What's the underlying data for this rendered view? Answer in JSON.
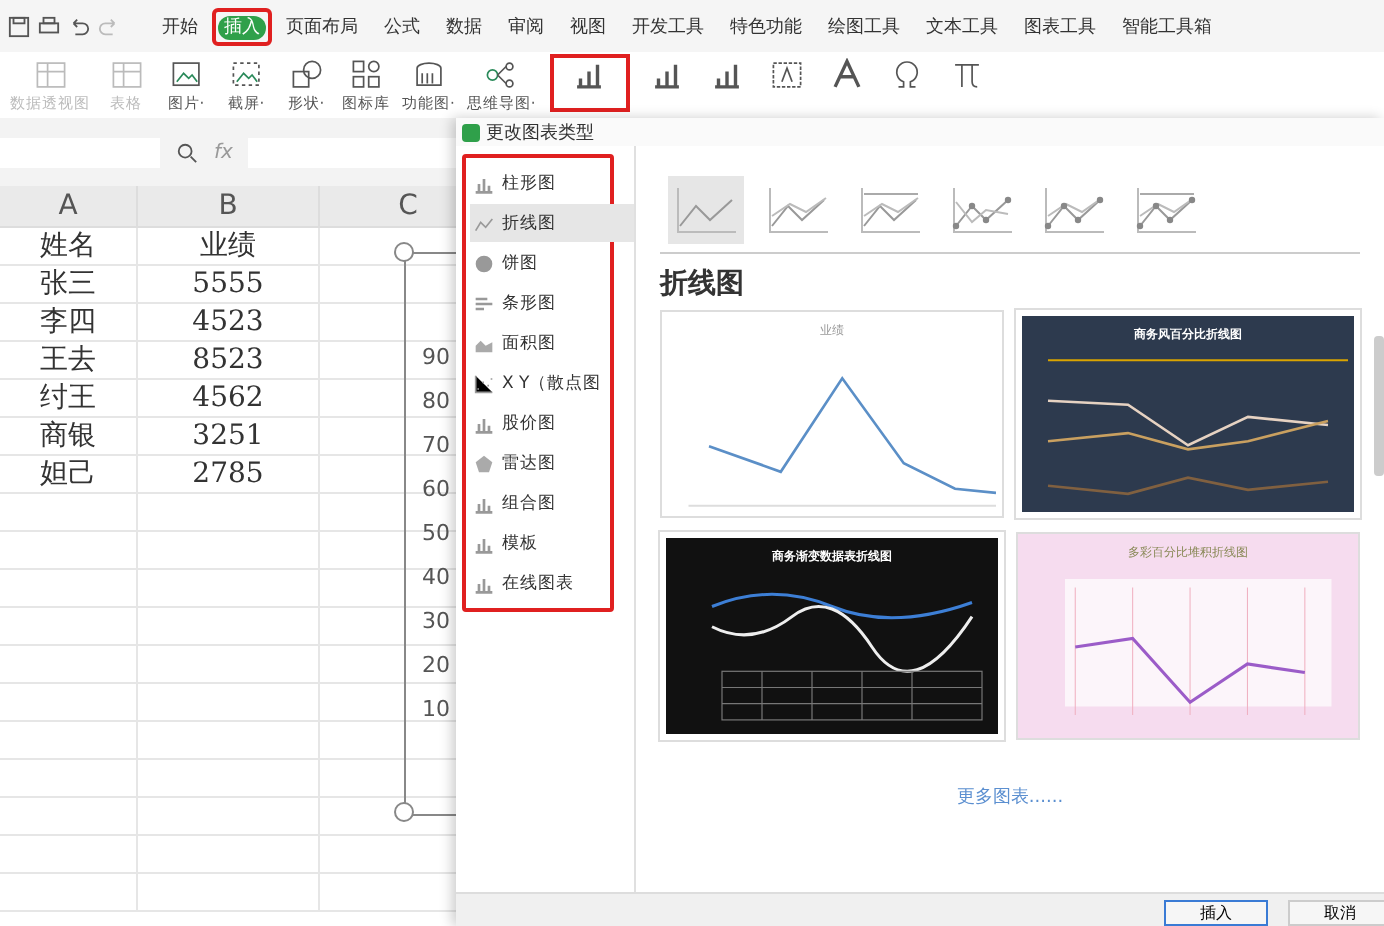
{
  "menu_tabs": [
    {
      "label": "开始",
      "selected": false,
      "annotated": false
    },
    {
      "label": "插入",
      "selected": true,
      "annotated": true
    },
    {
      "label": "页面布局",
      "selected": false,
      "annotated": false
    },
    {
      "label": "公式",
      "selected": false,
      "annotated": false
    },
    {
      "label": "数据",
      "selected": false,
      "annotated": false
    },
    {
      "label": "审阅",
      "selected": false,
      "annotated": false
    },
    {
      "label": "视图",
      "selected": false,
      "annotated": false
    },
    {
      "label": "开发工具",
      "selected": false,
      "annotated": false
    },
    {
      "label": "特色功能",
      "selected": false,
      "annotated": false
    },
    {
      "label": "绘图工具",
      "selected": false,
      "annotated": false
    },
    {
      "label": "文本工具",
      "selected": false,
      "annotated": false
    },
    {
      "label": "图表工具",
      "selected": false,
      "annotated": false
    },
    {
      "label": "智能工具箱",
      "selected": false,
      "annotated": false
    }
  ],
  "ribbon_tools": [
    {
      "kind": "pivot",
      "label": "数据透视图",
      "disabled": true,
      "annotated": false
    },
    {
      "kind": "table",
      "label": "表格",
      "disabled": true,
      "annotated": false
    },
    {
      "kind": "picture",
      "label": "图片·",
      "disabled": false,
      "annotated": false
    },
    {
      "kind": "screenshot",
      "label": "截屏·",
      "disabled": false,
      "annotated": false
    },
    {
      "kind": "shapes",
      "label": "形状·",
      "disabled": false,
      "annotated": false
    },
    {
      "kind": "iconlib",
      "label": "图标库",
      "disabled": false,
      "annotated": false
    },
    {
      "kind": "function",
      "label": "功能图·",
      "disabled": false,
      "annotated": false
    },
    {
      "kind": "mindmap",
      "label": "思维导图·",
      "disabled": false,
      "annotated": false
    },
    {
      "kind": "allcharts",
      "disabled": false,
      "annotated": true
    },
    {
      "kind": "online",
      "disabled": false,
      "annotated": false
    },
    {
      "kind": "smallcharts",
      "disabled": false,
      "annotated": false
    },
    {
      "kind": "textbox",
      "disabled": false,
      "annotated": false
    },
    {
      "kind": "wordart",
      "disabled": false,
      "annotated": false
    },
    {
      "kind": "symbol",
      "disabled": false,
      "annotated": false
    },
    {
      "kind": "formula",
      "disabled": false,
      "annotated": false
    }
  ],
  "formula_bar": {
    "fx": "fx"
  },
  "sheet": {
    "columns": [
      "A",
      "B",
      "C"
    ],
    "rows": [
      [
        "姓名",
        "业绩"
      ],
      [
        "张三",
        "5555"
      ],
      [
        "李四",
        "4523"
      ],
      [
        "王去",
        "8523"
      ],
      [
        "纣王",
        "4562"
      ],
      [
        "商银",
        "3251"
      ],
      [
        "妲己",
        "2785"
      ]
    ],
    "chart_axis_labels": [
      "90",
      "80",
      "70",
      "60",
      "50",
      "40",
      "30",
      "20",
      "10"
    ]
  },
  "dialog": {
    "title": "更改图表类型",
    "types_annotated": true,
    "chart_types": [
      {
        "kind": "bar",
        "label": "柱形图",
        "selected": false
      },
      {
        "kind": "line",
        "label": "折线图",
        "selected": true
      },
      {
        "kind": "pie",
        "label": "饼图",
        "selected": false
      },
      {
        "kind": "hbar",
        "label": "条形图",
        "selected": false
      },
      {
        "kind": "area",
        "label": "面积图",
        "selected": false
      },
      {
        "kind": "scatter",
        "label": "X Y（散点图",
        "selected": false
      },
      {
        "kind": "stock",
        "label": "股价图",
        "selected": false
      },
      {
        "kind": "radar",
        "label": "雷达图",
        "selected": false
      },
      {
        "kind": "combo",
        "label": "组合图",
        "selected": false
      },
      {
        "kind": "template",
        "label": "模板",
        "selected": false
      },
      {
        "kind": "online",
        "label": "在线图表",
        "selected": false
      }
    ],
    "subtypes": [
      {
        "kind": "line",
        "selected": true
      },
      {
        "kind": "stacked",
        "selected": false
      },
      {
        "kind": "percent",
        "selected": false
      },
      {
        "kind": "marker",
        "selected": false
      },
      {
        "kind": "stacked-marker",
        "selected": false
      },
      {
        "kind": "percent-marker",
        "selected": false
      }
    ],
    "section_title": "折线图",
    "templates": [
      {
        "kind": "plain",
        "title": "业绩"
      },
      {
        "kind": "dark-percent",
        "title": "商务风百分比折线图"
      },
      {
        "kind": "black-gradient",
        "title": "商务渐变数据表折线图"
      },
      {
        "kind": "pink-stacked",
        "title": "多彩百分比堆积折线图"
      }
    ],
    "more_link": "更多图表......",
    "buttons": [
      {
        "label": "插入",
        "primary": true
      },
      {
        "label": "取消",
        "primary": false
      }
    ]
  }
}
